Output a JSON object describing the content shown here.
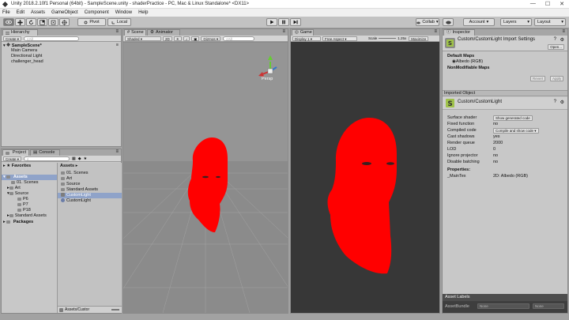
{
  "window": {
    "title": "Unity 2018.2.10f1 Personal (64bit) - SampleScene.unity - shaderPractice - PC, Mac & Linux Standalone* <DX11>",
    "controls": [
      "—",
      "☐",
      "✕"
    ]
  },
  "menu": [
    "File",
    "Edit",
    "Assets",
    "GameObject",
    "Component",
    "Window",
    "Help"
  ],
  "toolbar": {
    "pivot": "Pivot",
    "local": "Local",
    "collab": "Collab",
    "account": "Account",
    "layers": "Layers",
    "layout": "Layout"
  },
  "hierarchy": {
    "tab": "Hierarchy",
    "create": "Create",
    "search_placeholder": "All",
    "scene": "SampleScene*",
    "items": [
      "Main Camera",
      "Directional Light",
      "challenger_head"
    ]
  },
  "scene_view": {
    "tab_scene": "Scene",
    "tab_animator": "Animator",
    "shading": "Shaded",
    "mode2d": "2D",
    "gizmos": "Gizmos",
    "search_placeholder": "All",
    "persp": "Persp",
    "face_color": "#ff0000",
    "bg_color": "#8c8c8c"
  },
  "game_view": {
    "tab": "Game",
    "display": "Display 1",
    "aspect": "Free Aspect",
    "scale_label": "Scale",
    "scale": "1.25x",
    "maximize": "Maximize",
    "face_color": "#ff0000",
    "bg_color": "#373737"
  },
  "project": {
    "tab_project": "Project",
    "tab_console": "Console",
    "create": "Create",
    "favorites": "Favorites",
    "tree_assets": "Assets",
    "tree": [
      "01. Scenes",
      "Art",
      "Source",
      "P6",
      "P7",
      "P18",
      "Standard Assets"
    ],
    "packages": "Packages",
    "breadcrumb": "Assets",
    "list": [
      "01. Scenes",
      "Art",
      "Source",
      "Standard Assets",
      "CustomLight",
      "CustomLight"
    ],
    "footer": "Assets/Custor"
  },
  "inspector": {
    "tab": "Inspector",
    "title": "Custom/CustomLight Import Settings",
    "open": "Open...",
    "default_maps": "Default Maps",
    "albedo": "Albedo (RGB)",
    "nonmodifiable": "NonModifiable Maps",
    "revert": "Revert",
    "apply": "Apply",
    "imported_object": "Imported Object",
    "shader_name": "Custom/CustomLight",
    "props": [
      {
        "k": "Surface shader",
        "v": "Show generated code"
      },
      {
        "k": "Fixed function",
        "v": "no"
      },
      {
        "k": "Compiled code",
        "v": "Compile and show code ▾"
      },
      {
        "k": "Cast shadows",
        "v": "yes"
      },
      {
        "k": "Render queue",
        "v": "2000"
      },
      {
        "k": "LOD",
        "v": "0"
      },
      {
        "k": "Ignore projector",
        "v": "no"
      },
      {
        "k": "Disable batching",
        "v": "no"
      }
    ],
    "properties_label": "Properties:",
    "prop_name": "_MainTex",
    "prop_value": "2D: Albedo (RGB)",
    "asset_labels": "Asset Labels",
    "asset_bundle": "AssetBundle",
    "none1": "None",
    "none2": "None"
  }
}
